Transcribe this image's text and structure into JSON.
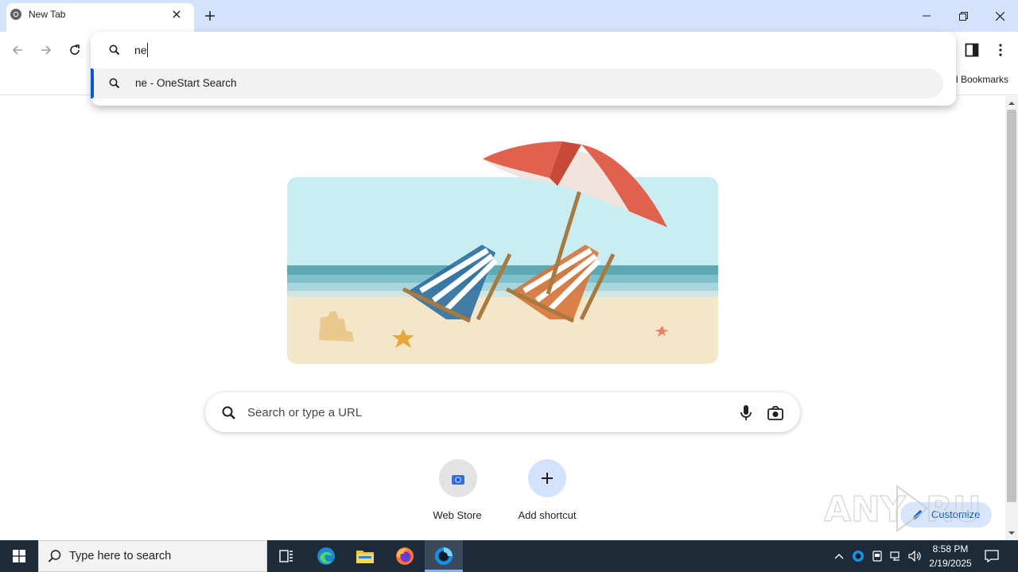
{
  "browser": {
    "tab_title": "New Tab",
    "bookmarks_label": "l Bookmarks"
  },
  "omnibox": {
    "input_value": "ne",
    "suggestion": "ne - OneStart Search"
  },
  "ntp": {
    "search_placeholder": "Search or type a URL",
    "shortcuts": [
      {
        "label": "Web Store",
        "icon": "web-store-icon"
      },
      {
        "label": "Add shortcut",
        "icon": "plus-icon"
      }
    ],
    "customize_label": "Customize",
    "watermark_text": "ANY RUN"
  },
  "taskbar": {
    "search_placeholder": "Type here to search",
    "apps": [
      "task-view-icon",
      "edge-icon",
      "file-explorer-icon",
      "firefox-icon",
      "onestart-browser-icon"
    ],
    "tray_icons": [
      "chevron-up-icon",
      "onestart-tray-icon",
      "device-icon",
      "network-icon",
      "volume-icon"
    ],
    "time": "8:58 PM",
    "date": "2/19/2025"
  },
  "colors": {
    "titlebar": "#d3e3fd",
    "accent": "#0b57d0",
    "taskbar": "#1c2a3a"
  }
}
